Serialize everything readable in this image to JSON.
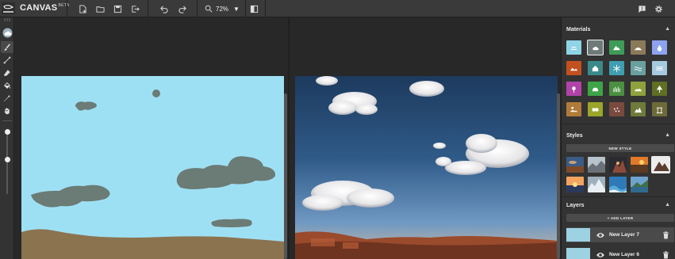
{
  "app": {
    "name": "CANVAS",
    "badge": "BETA"
  },
  "toolbar": {
    "zoom_value": "72%",
    "buttons": [
      "new-file-icon",
      "open-folder-icon",
      "save-icon",
      "export-icon",
      "undo-icon",
      "redo-icon",
      "zoom-icon",
      "split-view-icon",
      "feedback-icon",
      "settings-icon"
    ]
  },
  "tools": [
    "paint-bucket-drop-icon",
    "brush-icon",
    "line-icon",
    "eraser-icon",
    "fill-icon",
    "eyedropper-icon",
    "pan-hand-icon"
  ],
  "panel": {
    "materials_title": "Materials",
    "styles_title": "Styles",
    "new_style_label": "NEW STYLE",
    "layers_title": "Layers",
    "add_layer_label": "+ ADD LAYER",
    "materials": [
      {
        "name": "sky",
        "color": "#8fd3e6"
      },
      {
        "name": "cloud",
        "color": "#6e7a78"
      },
      {
        "name": "mountain",
        "color": "#3f9b58"
      },
      {
        "name": "hill",
        "color": "#8b7a5a"
      },
      {
        "name": "water-drop",
        "color": "#8da3ef"
      },
      {
        "name": "dirt",
        "color": "#c3501f"
      },
      {
        "name": "house",
        "color": "#3a8a8a"
      },
      {
        "name": "snowflake",
        "color": "#3f9fb0"
      },
      {
        "name": "sea",
        "color": "#6aa0a0"
      },
      {
        "name": "fog",
        "color": "#a5c9df"
      },
      {
        "name": "flower",
        "color": "#b143a8"
      },
      {
        "name": "bush",
        "color": "#3da548"
      },
      {
        "name": "grass",
        "color": "#4a9040"
      },
      {
        "name": "hills-green",
        "color": "#8ea13c"
      },
      {
        "name": "tree",
        "color": "#5f6f23"
      },
      {
        "name": "sand",
        "color": "#b07b39"
      },
      {
        "name": "shrub",
        "color": "#9aa52a"
      },
      {
        "name": "gravel",
        "color": "#7a4a3e"
      },
      {
        "name": "rock",
        "color": "#6e7b3a"
      },
      {
        "name": "ruins",
        "color": "#6d6a3a"
      }
    ],
    "layers": [
      {
        "name": "New Layer 7",
        "selected": true
      },
      {
        "name": "New Layer 6",
        "selected": false
      }
    ]
  },
  "colors": {
    "sky": "#9ee0f3",
    "cloud": "#6b7b75",
    "ground": "#8b7350",
    "panel": "#333333"
  }
}
